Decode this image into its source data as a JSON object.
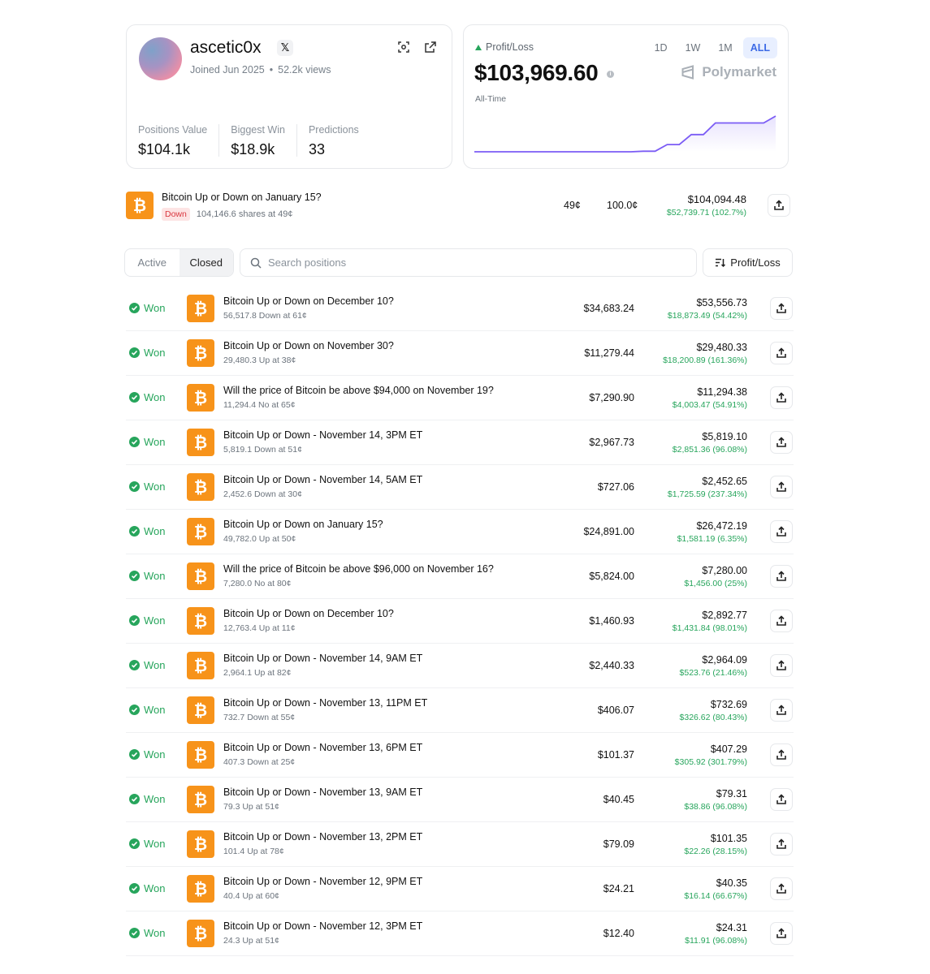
{
  "profile": {
    "username": "ascetic0x",
    "x_badge": "𝕏",
    "joined": "Joined Jun 2025",
    "separator": "•",
    "views": "52.2k views",
    "stats": [
      {
        "label": "Positions Value",
        "value": "$104.1k"
      },
      {
        "label": "Biggest Win",
        "value": "$18.9k"
      },
      {
        "label": "Predictions",
        "value": "33"
      }
    ]
  },
  "pnl": {
    "label": "Profit/Loss",
    "value": "$103,969.60",
    "info": "i",
    "period": "All-Time",
    "ranges": [
      "1D",
      "1W",
      "1M",
      "ALL"
    ],
    "active_range": "ALL",
    "brand": "Polymarket",
    "line_color": "#7b5cf5",
    "positive_color": "#27a55c"
  },
  "chart_data": {
    "type": "area",
    "series": [
      {
        "values": [
          0,
          0,
          0,
          0,
          0,
          0,
          0,
          0,
          0,
          0,
          0,
          0,
          0,
          0,
          1581,
          1581,
          21000,
          21000,
          50000,
          50000,
          84000,
          84000,
          84000,
          84000,
          84000,
          103969.6
        ]
      }
    ],
    "xlabel": "",
    "ylabel": ""
  },
  "featured": {
    "icon": "₿",
    "title": "Bitcoin Up or Down on January 15?",
    "outcome": "Down",
    "shares": "104,146.6 shares at 49¢",
    "avg": "49¢",
    "current": "100.0¢",
    "value": "$104,094.48",
    "pnl": "$52,739.71 (102.7%)"
  },
  "toolbar": {
    "tabs": [
      "Active",
      "Closed"
    ],
    "active_tab": "Closed",
    "search_placeholder": "Search positions",
    "sort_label": "Profit/Loss"
  },
  "positions": [
    {
      "status": "Won",
      "title": "Bitcoin Up or Down on December 10?",
      "sub": "56,517.8 Down at 61¢",
      "bet": "$34,683.24",
      "value": "$53,556.73",
      "pnl": "$18,873.49 (54.42%)"
    },
    {
      "status": "Won",
      "title": "Bitcoin Up or Down on November 30?",
      "sub": "29,480.3 Up at 38¢",
      "bet": "$11,279.44",
      "value": "$29,480.33",
      "pnl": "$18,200.89 (161.36%)"
    },
    {
      "status": "Won",
      "title": "Will the price of Bitcoin be above $94,000 on November 19?",
      "sub": "11,294.4 No at 65¢",
      "bet": "$7,290.90",
      "value": "$11,294.38",
      "pnl": "$4,003.47 (54.91%)"
    },
    {
      "status": "Won",
      "title": "Bitcoin Up or Down - November 14, 3PM ET",
      "sub": "5,819.1 Down at 51¢",
      "bet": "$2,967.73",
      "value": "$5,819.10",
      "pnl": "$2,851.36 (96.08%)"
    },
    {
      "status": "Won",
      "title": "Bitcoin Up or Down - November 14, 5AM ET",
      "sub": "2,452.6 Down at 30¢",
      "bet": "$727.06",
      "value": "$2,452.65",
      "pnl": "$1,725.59 (237.34%)"
    },
    {
      "status": "Won",
      "title": "Bitcoin Up or Down on January 15?",
      "sub": "49,782.0 Up at 50¢",
      "bet": "$24,891.00",
      "value": "$26,472.19",
      "pnl": "$1,581.19 (6.35%)"
    },
    {
      "status": "Won",
      "title": "Will the price of Bitcoin be above $96,000 on November 16?",
      "sub": "7,280.0 No at 80¢",
      "bet": "$5,824.00",
      "value": "$7,280.00",
      "pnl": "$1,456.00 (25%)"
    },
    {
      "status": "Won",
      "title": "Bitcoin Up or Down on December 10?",
      "sub": "12,763.4 Up at 11¢",
      "bet": "$1,460.93",
      "value": "$2,892.77",
      "pnl": "$1,431.84 (98.01%)"
    },
    {
      "status": "Won",
      "title": "Bitcoin Up or Down - November 14, 9AM ET",
      "sub": "2,964.1 Up at 82¢",
      "bet": "$2,440.33",
      "value": "$2,964.09",
      "pnl": "$523.76 (21.46%)"
    },
    {
      "status": "Won",
      "title": "Bitcoin Up or Down - November 13, 11PM ET",
      "sub": "732.7 Down at 55¢",
      "bet": "$406.07",
      "value": "$732.69",
      "pnl": "$326.62 (80.43%)"
    },
    {
      "status": "Won",
      "title": "Bitcoin Up or Down - November 13, 6PM ET",
      "sub": "407.3 Down at 25¢",
      "bet": "$101.37",
      "value": "$407.29",
      "pnl": "$305.92 (301.79%)"
    },
    {
      "status": "Won",
      "title": "Bitcoin Up or Down - November 13, 9AM ET",
      "sub": "79.3 Up at 51¢",
      "bet": "$40.45",
      "value": "$79.31",
      "pnl": "$38.86 (96.08%)"
    },
    {
      "status": "Won",
      "title": "Bitcoin Up or Down - November 13, 2PM ET",
      "sub": "101.4 Up at 78¢",
      "bet": "$79.09",
      "value": "$101.35",
      "pnl": "$22.26 (28.15%)"
    },
    {
      "status": "Won",
      "title": "Bitcoin Up or Down - November 12, 9PM ET",
      "sub": "40.4 Up at 60¢",
      "bet": "$24.21",
      "value": "$40.35",
      "pnl": "$16.14 (66.67%)"
    },
    {
      "status": "Won",
      "title": "Bitcoin Up or Down - November 12, 3PM ET",
      "sub": "24.3 Up at 51¢",
      "bet": "$12.40",
      "value": "$24.31",
      "pnl": "$11.91 (96.08%)"
    }
  ]
}
